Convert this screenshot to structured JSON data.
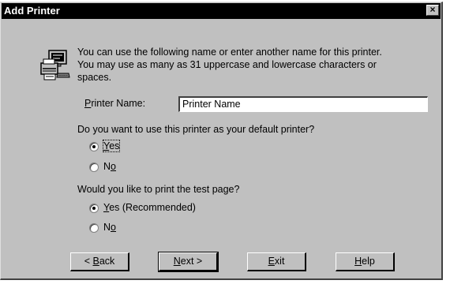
{
  "window": {
    "title": "Add Printer",
    "close_glyph": "×"
  },
  "icon": {
    "name": "printer-icon"
  },
  "intro": {
    "line1": "You can use the following name or enter another name for this printer.",
    "line2": "You may use as many as 31 uppercase and lowercase characters or",
    "line3": "spaces."
  },
  "printer_name": {
    "label_mnemonic": "P",
    "label_rest": "rinter Name:",
    "value": "Printer Name"
  },
  "default_question": {
    "text": "Do you want to use this printer as your default printer?",
    "yes_mnemonic": "Y",
    "yes_rest": "es",
    "no_prefix": "N",
    "no_mnemonic": "o",
    "selected": "Yes"
  },
  "test_question": {
    "text": "Would you like to print the test page?",
    "yes_mnemonic": "Y",
    "yes_rest": "es (Recommended)",
    "no_prefix": "N",
    "no_mnemonic": "o",
    "selected": "Yes (Recommended)"
  },
  "buttons": {
    "back_prefix": "< ",
    "back_mnemonic": "B",
    "back_rest": "ack",
    "next_mnemonic": "N",
    "next_rest": "ext >",
    "exit_mnemonic": "E",
    "exit_rest": "xit",
    "help_mnemonic": "H",
    "help_rest": "elp"
  }
}
